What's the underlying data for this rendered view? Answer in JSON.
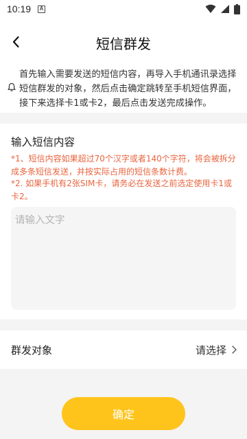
{
  "status_bar": {
    "time": "10:19",
    "notification_letter": "A"
  },
  "header": {
    "title": "短信群发"
  },
  "notice": {
    "text": "首先输入需要发送的短信内容，再导入手机通讯录选择短信群发的对象，然后点击确定跳转至手机短信界面，接下来选择卡1或卡2，最后点击发送完成操作。"
  },
  "message": {
    "section_title": "输入短信内容",
    "warning_1": "*1、短信内容如果超过70个汉字或者140个字符，将会被拆分成多条短信发送，并按实际占用的短信条数计费。",
    "warning_2": "*2. 如果手机有2张SIM卡，请务必在发送之前选定使用卡1或卡2。",
    "placeholder": "请输入文字",
    "value": ""
  },
  "recipients": {
    "label": "群发对象",
    "value": "请选择"
  },
  "confirm": {
    "label": "确定"
  },
  "colors": {
    "accent": "#ffc41c",
    "warning": "#e8643f",
    "background": "#f4f4f4"
  }
}
